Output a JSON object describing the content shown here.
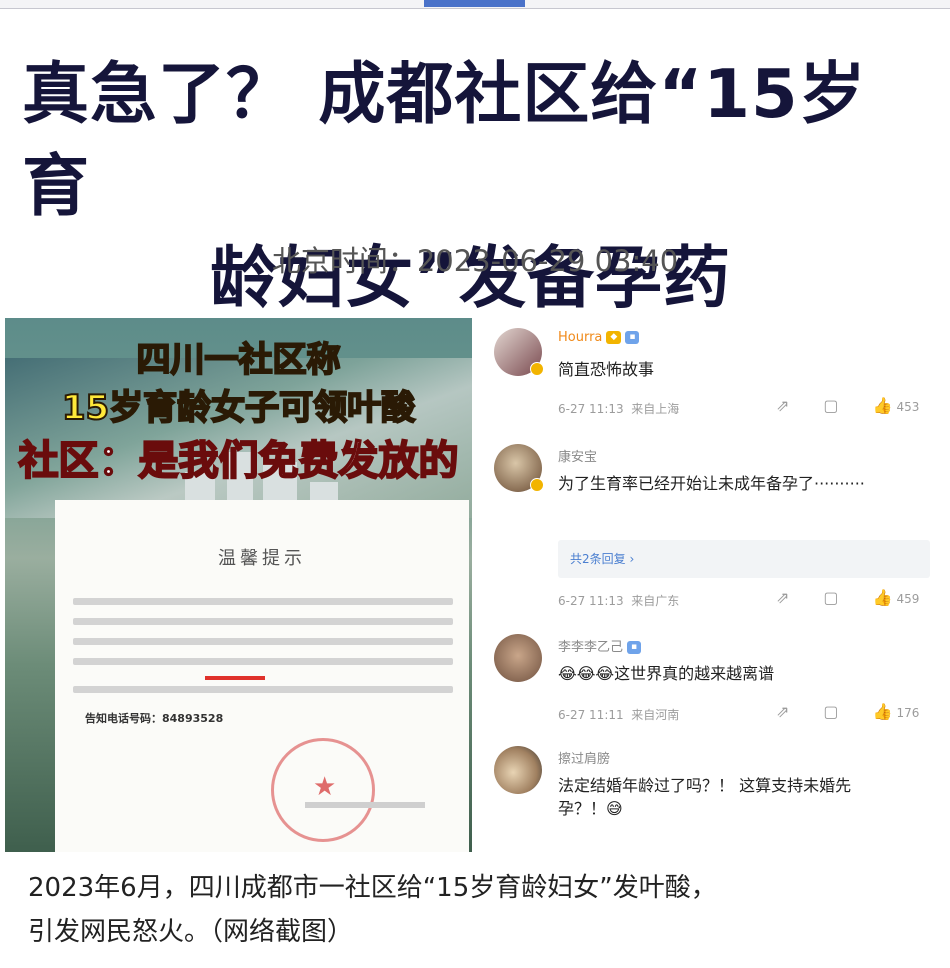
{
  "headline_line1": "真急了？ 成都社区给“15岁育",
  "headline_line2": "龄妇女”发备孕药",
  "timestamp": "北京时间：2023-06-29 03:40",
  "image": {
    "banner_line1": "四川一社区称",
    "banner_line2": "15岁育龄女子可领叶酸",
    "banner_line3": "社区：是我们免费发放的",
    "notice_title": "温馨提示",
    "notice_phone": "告知电话号码：84893528"
  },
  "comments": [
    {
      "user": "Hourra",
      "text": "简直恐怖故事",
      "time": "6-27 11:13",
      "location": "来自上海",
      "likes": "453"
    },
    {
      "user": "康安宝",
      "text": "为了生育率已经开始让未成年备孕了··········",
      "replies": "共2条回复 ›",
      "time": "6-27 11:13",
      "location": "来自广东",
      "likes": "459"
    },
    {
      "user": "李李李乙己",
      "emoji": "😂😂😂",
      "text": "这世界真的越来越离谱",
      "time": "6-27 11:11",
      "location": "来自河南",
      "likes": "176"
    },
    {
      "user": "擦过肩膀",
      "text": "法定结婚年龄过了吗？！ 这算支持未婚先孕？！",
      "emoji": "😅"
    }
  ],
  "comment_icons": {
    "share": "⇗",
    "comment": "▢",
    "like": "👍"
  },
  "caption_line1": "2023年6月，四川成都市一社区给“15岁育龄妇女”发叶酸，",
  "caption_line2": "引发网民怒火。（网络截图）"
}
